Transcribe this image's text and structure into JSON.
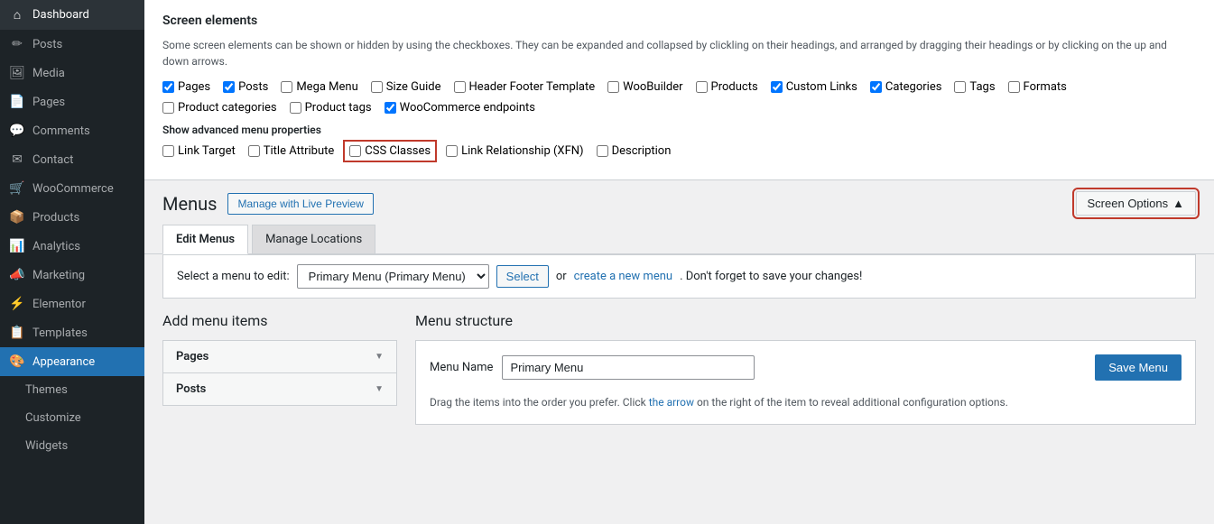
{
  "sidebar": {
    "items": [
      {
        "id": "dashboard",
        "label": "Dashboard",
        "icon": "⌂"
      },
      {
        "id": "posts",
        "label": "Posts",
        "icon": "📝"
      },
      {
        "id": "media",
        "label": "Media",
        "icon": "🖼"
      },
      {
        "id": "pages",
        "label": "Pages",
        "icon": "📄"
      },
      {
        "id": "comments",
        "label": "Comments",
        "icon": "💬"
      },
      {
        "id": "contact",
        "label": "Contact",
        "icon": "✉"
      },
      {
        "id": "woocommerce",
        "label": "WooCommerce",
        "icon": "🛒"
      },
      {
        "id": "products",
        "label": "Products",
        "icon": "📦"
      },
      {
        "id": "analytics",
        "label": "Analytics",
        "icon": "📊"
      },
      {
        "id": "marketing",
        "label": "Marketing",
        "icon": "📣"
      },
      {
        "id": "elementor",
        "label": "Elementor",
        "icon": "⚡"
      },
      {
        "id": "templates",
        "label": "Templates",
        "icon": "📋"
      },
      {
        "id": "appearance",
        "label": "Appearance",
        "icon": "🎨",
        "active": true
      },
      {
        "id": "themes",
        "label": "Themes",
        "icon": ""
      },
      {
        "id": "customize",
        "label": "Customize",
        "icon": ""
      },
      {
        "id": "widgets",
        "label": "Widgets",
        "icon": ""
      }
    ]
  },
  "screen_options": {
    "title": "Screen elements",
    "description": "Some screen elements can be shown or hidden by using the checkboxes. They can be expanded and collapsed by clickling on their headings, and arranged by dragging their headings or by clicking on the up and down arrows.",
    "checkboxes_row1": [
      {
        "id": "pages",
        "label": "Pages",
        "checked": true
      },
      {
        "id": "posts",
        "label": "Posts",
        "checked": true
      },
      {
        "id": "mega-menu",
        "label": "Mega Menu",
        "checked": false
      },
      {
        "id": "size-guide",
        "label": "Size Guide",
        "checked": false
      },
      {
        "id": "header-footer",
        "label": "Header Footer Template",
        "checked": false
      },
      {
        "id": "woobuilder",
        "label": "WooBuilder",
        "checked": false
      },
      {
        "id": "products",
        "label": "Products",
        "checked": false
      },
      {
        "id": "custom-links",
        "label": "Custom Links",
        "checked": true
      },
      {
        "id": "categories",
        "label": "Categories",
        "checked": true
      },
      {
        "id": "tags",
        "label": "Tags",
        "checked": false
      },
      {
        "id": "formats",
        "label": "Formats",
        "checked": false
      }
    ],
    "checkboxes_row2": [
      {
        "id": "product-categories",
        "label": "Product categories",
        "checked": false
      },
      {
        "id": "product-tags",
        "label": "Product tags",
        "checked": false
      },
      {
        "id": "woocommerce-endpoints",
        "label": "WooCommerce endpoints",
        "checked": true
      }
    ],
    "advanced_label": "Show advanced menu properties",
    "advanced_checkboxes": [
      {
        "id": "link-target",
        "label": "Link Target",
        "checked": false
      },
      {
        "id": "title-attribute",
        "label": "Title Attribute",
        "checked": false
      },
      {
        "id": "css-classes",
        "label": "CSS Classes",
        "checked": false,
        "highlight": true
      },
      {
        "id": "link-relationship",
        "label": "Link Relationship (XFN)",
        "checked": false
      },
      {
        "id": "description",
        "label": "Description",
        "checked": false
      }
    ]
  },
  "menus": {
    "title": "Menus",
    "manage_live_preview_btn": "Manage with Live Preview",
    "screen_options_btn": "Screen Options",
    "screen_options_arrow": "▲",
    "tabs": [
      {
        "id": "edit-menus",
        "label": "Edit Menus",
        "active": true
      },
      {
        "id": "manage-locations",
        "label": "Manage Locations",
        "active": false
      }
    ],
    "select_bar": {
      "label": "Select a menu to edit:",
      "dropdown_value": "Primary Menu (Primary Menu)",
      "select_btn": "Select",
      "or_text": "or",
      "create_link_text": "create a new menu",
      "reminder_text": "Don't forget to save your changes!"
    },
    "add_items": {
      "title": "Add menu items",
      "accordions": [
        {
          "id": "pages",
          "label": "Pages"
        },
        {
          "id": "posts",
          "label": "Posts"
        }
      ]
    },
    "structure": {
      "title": "Menu structure",
      "menu_name_label": "Menu Name",
      "menu_name_value": "Primary Menu",
      "save_menu_btn": "Save Menu",
      "drag_instructions": "Drag the items into the order you prefer. Click the arrow on the right of the item to reveal additional configuration options."
    }
  }
}
